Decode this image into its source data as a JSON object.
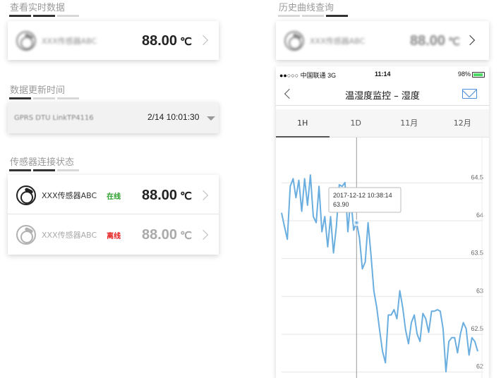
{
  "realtime": {
    "title": "查看实时数据",
    "sensor_name": "XXX传感器ABC",
    "value": "88.00",
    "unit": "℃"
  },
  "update_time": {
    "title": "数据更新时间",
    "device": "GPRS DTU LinkTP4116",
    "time": "2/14  10:01:30"
  },
  "connection": {
    "title": "传感器连接状态",
    "rows": [
      {
        "name": "XXX传感器ABC",
        "status": "在线",
        "status_color": "#2aa02a",
        "value": "88.00",
        "unit": "℃"
      },
      {
        "name": "XXX传感器ABC",
        "status": "离线",
        "status_color": "#e81e1e",
        "value": "88.00",
        "unit": "℃"
      }
    ]
  },
  "history": {
    "title": "历史曲线查询",
    "value": "88.00",
    "unit": "℃"
  },
  "phone": {
    "carrier": "●●○○○ 中国联通   3G",
    "clock": "11:14",
    "battery_text": "98%",
    "nav_title": "温湿度监控 – 湿度",
    "tabs": [
      "1H",
      "1D",
      "11月",
      "12月"
    ],
    "active_tab": "1H"
  },
  "colors": {
    "line": "#6aaee0",
    "status_online": "#2aa02a",
    "status_offline": "#e81e1e"
  },
  "chart_data": {
    "type": "line",
    "y_ticks": [
      "64.5",
      "64",
      "63.5",
      "63",
      "62.5",
      "62"
    ],
    "ylim": [
      61.95,
      64.95
    ],
    "tooltip": {
      "time": "2017-12-12 10:38:14",
      "value": "63.90"
    },
    "highlight_index": 26,
    "series": [
      {
        "values": [
          64.03,
          63.85,
          63.68,
          64.38,
          64.48,
          64.23,
          64.46,
          64.05,
          64.48,
          64.13,
          64.53,
          63.98,
          63.9,
          64.38,
          63.78,
          63.98,
          63.58,
          63.98,
          63.5,
          63.85,
          64.4,
          64.38,
          64.43,
          63.78,
          64.23,
          63.8,
          63.9,
          63.7,
          63.29,
          63.38,
          63.9,
          63.48,
          63.0,
          62.78,
          62.48,
          62.2,
          62.05,
          62.68,
          62.68,
          62.75,
          62.63,
          63.0,
          62.78,
          62.48,
          62.3,
          62.58,
          62.68,
          62.43,
          62.33,
          62.7,
          62.63,
          62.45,
          62.73,
          62.73,
          62.75,
          62.73,
          62.5,
          61.93,
          62.33,
          62.38,
          62.38,
          62.18,
          62.43,
          62.58,
          62.5,
          62.15,
          62.38,
          62.33,
          62.2
        ]
      }
    ]
  }
}
